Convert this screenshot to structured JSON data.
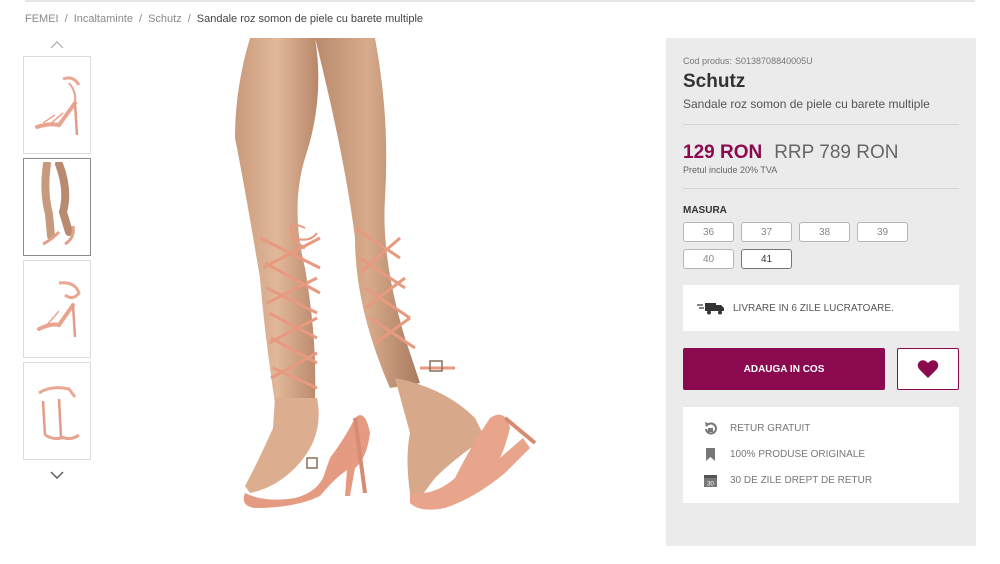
{
  "breadcrumb": {
    "items": [
      "FEMEI",
      "Incaltaminte",
      "Schutz"
    ],
    "current": "Sandale roz somon de piele cu barete multiple",
    "separator": "/"
  },
  "gallery": {
    "up_icon": "chevron-up-icon",
    "down_icon": "chevron-down-icon",
    "active_index": 1,
    "thumb_count": 4
  },
  "product": {
    "code_label": "Cod produs:",
    "code": "S0138708840005U",
    "brand": "Schutz",
    "name": "Sandale roz somon de piele cu barete multiple"
  },
  "pricing": {
    "price": "129 RON",
    "rrp": "RRP 789 RON",
    "vat_note": "Pretul include 20% TVA",
    "price_color": "#8b0a4f"
  },
  "sizes": {
    "title": "MASURA",
    "options": [
      {
        "label": "36",
        "available": false
      },
      {
        "label": "37",
        "available": false
      },
      {
        "label": "38",
        "available": false
      },
      {
        "label": "39",
        "available": false
      },
      {
        "label": "40",
        "available": false
      },
      {
        "label": "41",
        "available": true
      }
    ]
  },
  "delivery": {
    "icon": "truck-icon",
    "text": "LIVRARE IN 6 ZILE LUCRATOARE."
  },
  "actions": {
    "add_to_cart": "ADAUGA IN COS",
    "wishlist_icon": "heart-icon",
    "accent": "#8b0a4f"
  },
  "benefits": [
    {
      "icon": "return-icon",
      "text": "RETUR GRATUIT"
    },
    {
      "icon": "bookmark-icon",
      "text": "100% PRODUSE ORIGINALE"
    },
    {
      "icon": "calendar-icon",
      "text": "30 DE ZILE DREPT DE RETUR"
    }
  ]
}
